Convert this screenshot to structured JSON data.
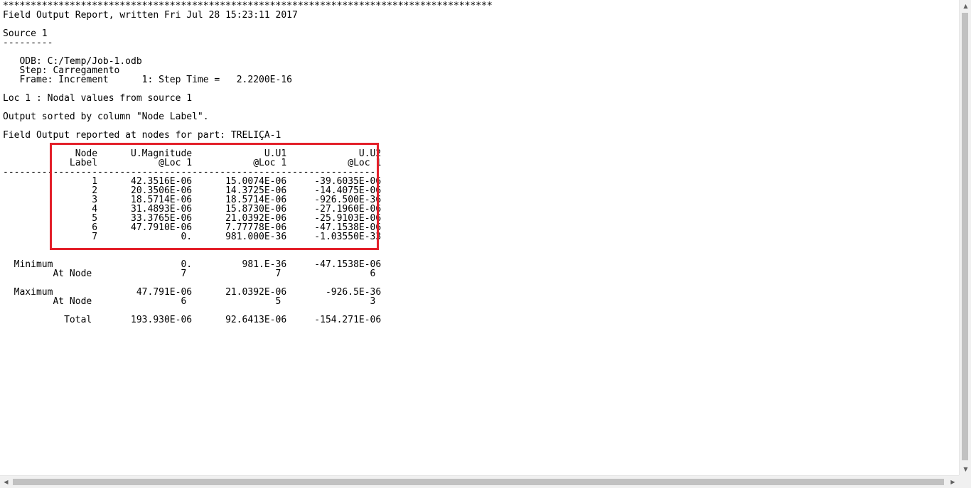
{
  "report": {
    "lines": [
      "****************************************************************************************",
      "Field Output Report, written Fri Jul 28 15:23:11 2017",
      "",
      "Source 1",
      "---------",
      "",
      "   ODB: C:/Temp/Job-1.odb",
      "   Step: Carregamento",
      "   Frame: Increment      1: Step Time =   2.2200E-16",
      "",
      "Loc 1 : Nodal values from source 1",
      "",
      "Output sorted by column \"Node Label\".",
      "",
      "Field Output reported at nodes for part: TRELIÇA-1",
      "",
      "             Node      U.Magnitude             U.U1             U.U2",
      "            Label           @Loc 1           @Loc 1           @Loc 1",
      "-------------------------------------------------------------------",
      "                1      42.3516E-06      15.0074E-06     -39.6035E-06",
      "                2      20.3506E-06      14.3725E-06     -14.4075E-06",
      "                3      18.5714E-06      18.5714E-06     -926.500E-36",
      "                4      31.4893E-06      15.8730E-06     -27.1960E-06",
      "                5      33.3765E-06      21.0392E-06     -25.9103E-06",
      "                6      47.7910E-06      7.77778E-06     -47.1538E-06",
      "                7               0.      981.000E-36     -1.03550E-33",
      "",
      "",
      "  Minimum                       0.         981.E-36     -47.1538E-06",
      "         At Node                7                7                6",
      "",
      "  Maximum               47.791E-06      21.0392E-06       -926.5E-36",
      "         At Node                6                5                3",
      "",
      "           Total       193.930E-06      92.6413E-06     -154.271E-06"
    ]
  },
  "scrollbars": {
    "up_arrow": "▲",
    "down_arrow": "▼",
    "left_arrow": "◀",
    "right_arrow": "▶"
  },
  "colors": {
    "highlight": "#e3202a",
    "text": "#000000",
    "background": "#ffffff"
  }
}
